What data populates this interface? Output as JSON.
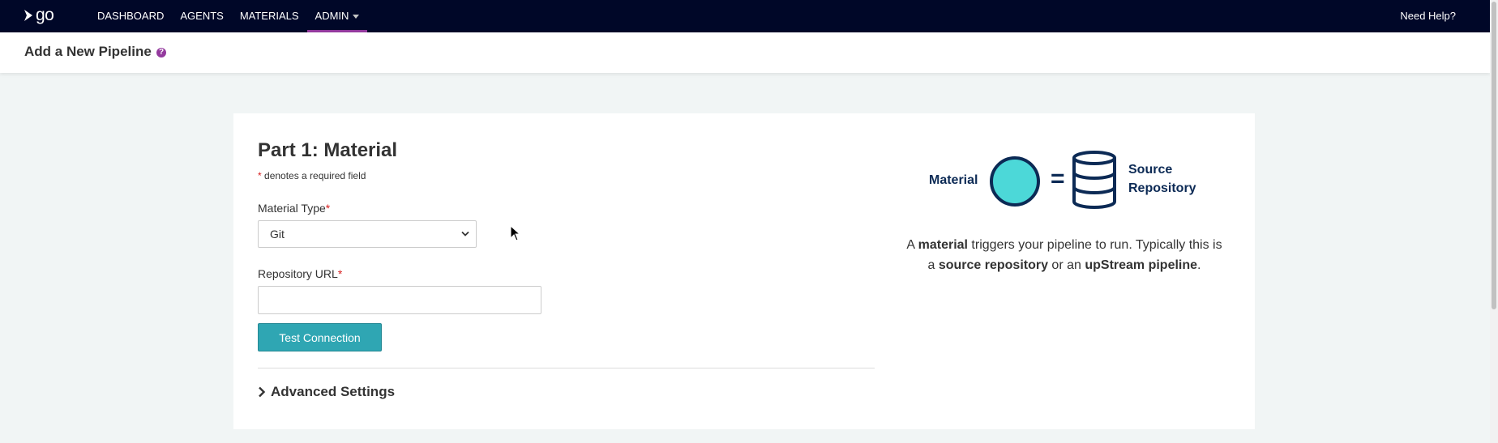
{
  "nav": {
    "logo_text": "go",
    "items": [
      {
        "label": "DASHBOARD"
      },
      {
        "label": "AGENTS"
      },
      {
        "label": "MATERIALS"
      },
      {
        "label": "ADMIN"
      }
    ],
    "active_index": 3,
    "help": "Need Help?"
  },
  "header": {
    "title": "Add a New Pipeline",
    "help_icon": "question-circle-icon"
  },
  "form": {
    "part_title": "Part 1: Material",
    "required_star": "*",
    "required_note": "denotes a required field",
    "material_type_label": "Material Type",
    "material_type_value": "Git",
    "repo_url_label": "Repository URL",
    "repo_url_value": "",
    "test_button": "Test Connection",
    "advanced": "Advanced Settings"
  },
  "illustration": {
    "left_word": "Material",
    "right_line1": "Source",
    "right_line2": "Repository",
    "equals": "="
  },
  "description": {
    "p1": "A ",
    "b1": "material",
    "p2": " triggers your pipeline to run. Typically this is a ",
    "b2": "source repository",
    "p3": " or an ",
    "b3": "upStream pipeline",
    "p4": "."
  },
  "colors": {
    "topnav_bg": "#000728",
    "accent_purple": "#943a9e",
    "button_teal": "#2fa6b3",
    "circle_fill": "#4cd8d8",
    "illustration_navy": "#0c2a55",
    "required_red": "#d71f1f"
  }
}
